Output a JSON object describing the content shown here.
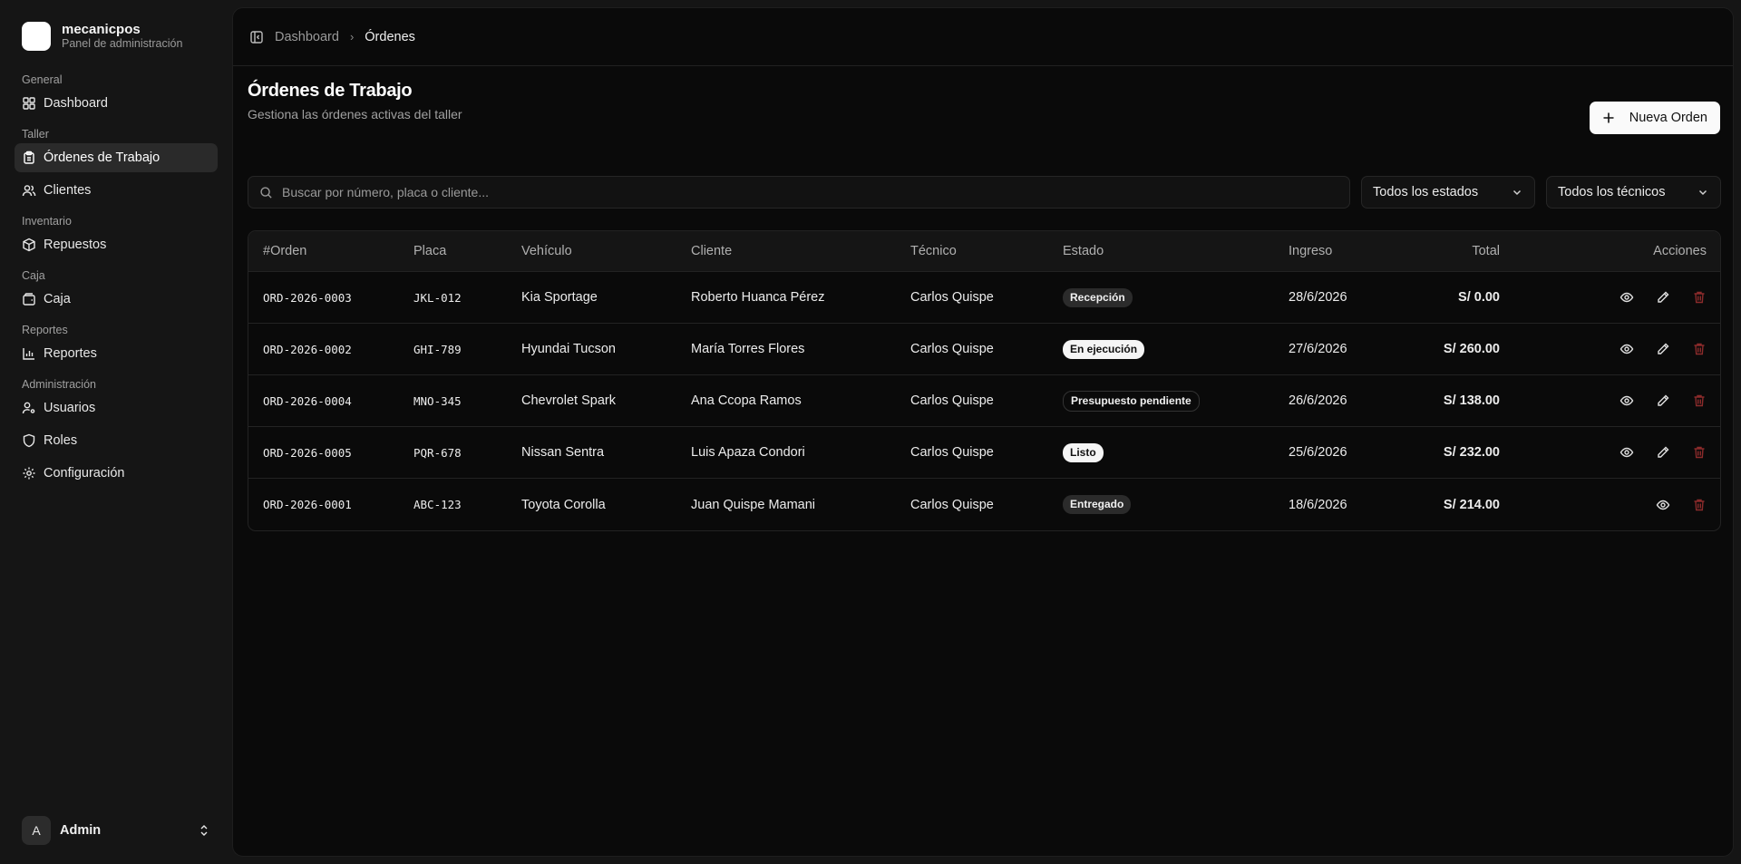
{
  "brand": {
    "name": "mecanicpos",
    "subtitle": "Panel de administración"
  },
  "sidebar": {
    "groups": [
      {
        "label": "General",
        "items": [
          {
            "label": "Dashboard"
          }
        ]
      },
      {
        "label": "Taller",
        "items": [
          {
            "label": "Órdenes de Trabajo"
          },
          {
            "label": "Clientes"
          }
        ]
      },
      {
        "label": "Inventario",
        "items": [
          {
            "label": "Repuestos"
          }
        ]
      },
      {
        "label": "Caja",
        "items": [
          {
            "label": "Caja"
          }
        ]
      },
      {
        "label": "Reportes",
        "items": [
          {
            "label": "Reportes"
          }
        ]
      },
      {
        "label": "Administración",
        "items": [
          {
            "label": "Usuarios"
          },
          {
            "label": "Roles"
          },
          {
            "label": "Configuración"
          }
        ]
      }
    ]
  },
  "user": {
    "initial": "A",
    "name": "Admin"
  },
  "breadcrumb": {
    "parent": "Dashboard",
    "current": "Órdenes"
  },
  "page": {
    "title": "Órdenes de Trabajo",
    "subtitle": "Gestiona las órdenes activas del taller",
    "new_button": "Nueva Orden"
  },
  "filters": {
    "search_placeholder": "Buscar por número, placa o cliente...",
    "status": "Todos los estados",
    "tech": "Todos los técnicos"
  },
  "table": {
    "headers": {
      "orden": "#Orden",
      "placa": "Placa",
      "vehiculo": "Vehículo",
      "cliente": "Cliente",
      "tecnico": "Técnico",
      "estado": "Estado",
      "ingreso": "Ingreso",
      "total": "Total",
      "acciones": "Acciones"
    },
    "rows": [
      {
        "orden": "ORD-2026-0003",
        "placa": "JKL-012",
        "vehiculo": "Kia Sportage",
        "cliente": "Roberto Huanca Pérez",
        "tecnico": "Carlos Quispe",
        "estado": "Recepción",
        "ingreso": "28/6/2026",
        "total": "S/ 0.00"
      },
      {
        "orden": "ORD-2026-0002",
        "placa": "GHI-789",
        "vehiculo": "Hyundai Tucson",
        "cliente": "María Torres Flores",
        "tecnico": "Carlos Quispe",
        "estado": "En ejecución",
        "ingreso": "27/6/2026",
        "total": "S/ 260.00"
      },
      {
        "orden": "ORD-2026-0004",
        "placa": "MNO-345",
        "vehiculo": "Chevrolet Spark",
        "cliente": "Ana Ccopa Ramos",
        "tecnico": "Carlos Quispe",
        "estado": "Presupuesto pendiente",
        "ingreso": "26/6/2026",
        "total": "S/ 138.00"
      },
      {
        "orden": "ORD-2026-0005",
        "placa": "PQR-678",
        "vehiculo": "Nissan Sentra",
        "cliente": "Luis Apaza Condori",
        "tecnico": "Carlos Quispe",
        "estado": "Listo",
        "ingreso": "25/6/2026",
        "total": "S/ 232.00"
      },
      {
        "orden": "ORD-2026-0001",
        "placa": "ABC-123",
        "vehiculo": "Toyota Corolla",
        "cliente": "Juan Quispe Mamani",
        "tecnico": "Carlos Quispe",
        "estado": "Entregado",
        "ingreso": "18/6/2026",
        "total": "S/ 214.00"
      }
    ]
  },
  "colors": {
    "delete": "#8b2b2b",
    "panel": "#0a0a0a",
    "sidebar": "#151515"
  }
}
